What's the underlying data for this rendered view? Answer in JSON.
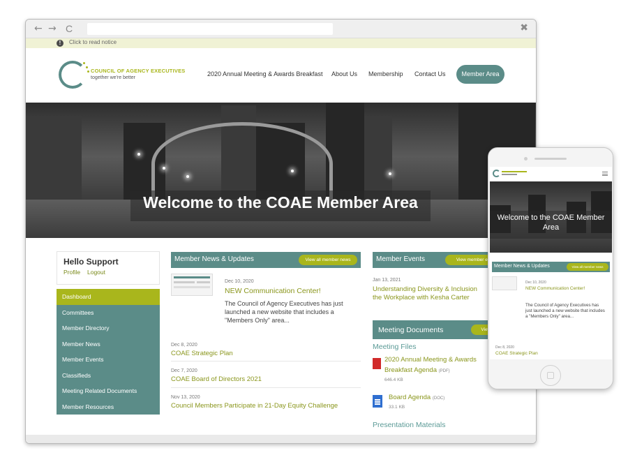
{
  "browser": {
    "back_glyph": "←",
    "forward_glyph": "→",
    "reload_glyph": "C",
    "close_glyph": "✖"
  },
  "notice": {
    "icon": "!",
    "text": "Click to read notice"
  },
  "header": {
    "logo_name": "COUNCIL OF AGENCY EXECUTIVES",
    "logo_tagline": "together we're better",
    "nav": [
      "2020 Annual Meeting & Awards Breakfast",
      "About Us",
      "Membership",
      "Contact Us"
    ],
    "member_area_button": "Member Area"
  },
  "hero": {
    "title": "Welcome to the COAE Member Area"
  },
  "sidebar": {
    "greeting": "Hello Support",
    "profile_link": "Profile",
    "logout_link": "Logout",
    "menu": [
      "Dashboard",
      "Committees",
      "Member Directory",
      "Member News",
      "Member Events",
      "Classifieds",
      "Meeting Related Documents",
      "Member Resources"
    ],
    "active_index": 0
  },
  "news": {
    "heading": "Member News & Updates",
    "view_all": "View all member news",
    "featured": {
      "date": "Dec 10, 2020",
      "title": "NEW Communication Center!",
      "body": "The Council of Agency Executives has just launched a new website that includes a \"Members Only\" area..."
    },
    "items": [
      {
        "date": "Dec 8, 2020",
        "title": "COAE Strategic Plan"
      },
      {
        "date": "Dec 7, 2020",
        "title": "COAE Board of Directors 2021"
      },
      {
        "date": "Nov 13, 2020",
        "title": "Council Members Participate in 21-Day Equity Challenge"
      }
    ]
  },
  "events": {
    "heading": "Member Events",
    "view_all": "View member ev",
    "item": {
      "date": "Jan 13, 2021",
      "title_line1": "Understanding Diversity & Inclusion",
      "title_line2": "the Workplace with Kesha Carter"
    }
  },
  "documents": {
    "heading": "Meeting Documents",
    "view_all": "View m",
    "files_heading": "Meeting Files",
    "files": [
      {
        "line1": "2020 Annual Meeting & Awards",
        "line2": "Breakfast Agenda",
        "type": "(PDF)",
        "size": "646.4 KB",
        "icon": "pdf-icon"
      },
      {
        "line1": "Board Agenda",
        "type": "(DOC)",
        "size": "33.1 KB",
        "icon": "doc-icon"
      }
    ],
    "presentation_heading": "Presentation Materials"
  },
  "phone": {
    "hero_title": "Welcome to the COAE Member Area",
    "news_heading": "Member News & Updates",
    "view_all": "View all member news",
    "featured": {
      "date": "Dec 10, 2020",
      "title": "NEW Communication Center!",
      "body": "The Council of Agency Executives has just launched a new website that includes a \"Members Only\" area..."
    },
    "next_item": {
      "date": "Dec 8, 2020",
      "title": "COAE Strategic Plan"
    }
  },
  "colors": {
    "teal": "#5b8c88",
    "olive": "#a9b61c",
    "link_olive": "#8a961c"
  }
}
